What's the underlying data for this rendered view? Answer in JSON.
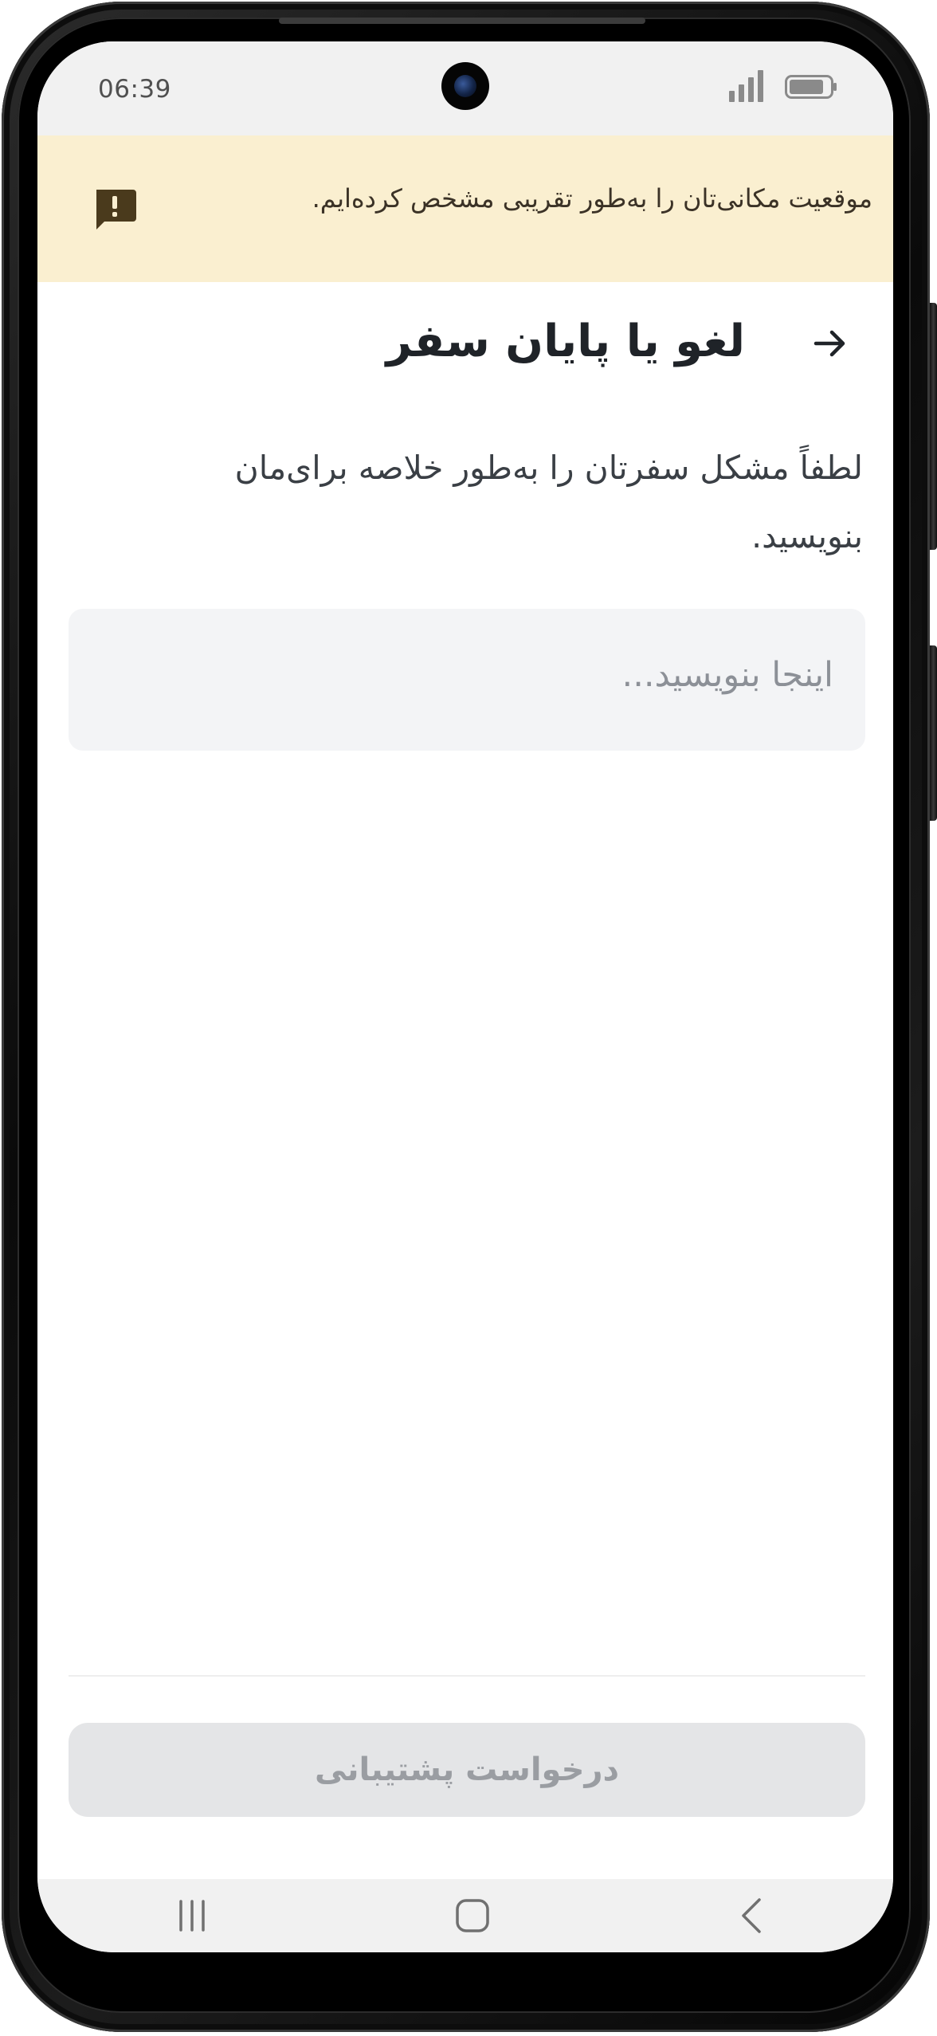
{
  "status_bar": {
    "time": "06:39"
  },
  "notice": {
    "text": "موقعیت مکانی‌تان را به‌طور تقریبی مشخص کرده‌ایم.",
    "icon": "feedback-alert-icon",
    "background_color": "#faefd0"
  },
  "header": {
    "title": "لغو یا پایان سفر",
    "back_icon": "arrow-right-icon"
  },
  "form": {
    "instruction": "لطفاً مشکل سفرتان را به‌طور خلاصه برای‌مان بنویسید.",
    "input_placeholder": "اینجا بنویسید...",
    "input_value": ""
  },
  "actions": {
    "support_button_label": "درخواست پشتیبانی",
    "support_button_state": "disabled"
  },
  "navigation": {
    "icons": [
      "recents-icon",
      "home-icon",
      "back-icon"
    ]
  },
  "colors": {
    "banner": "#faefd0",
    "title": "#1f2328",
    "input_bg": "#f3f4f6",
    "button_disabled_bg": "#e4e5e7",
    "button_disabled_text": "#9a9da2"
  }
}
